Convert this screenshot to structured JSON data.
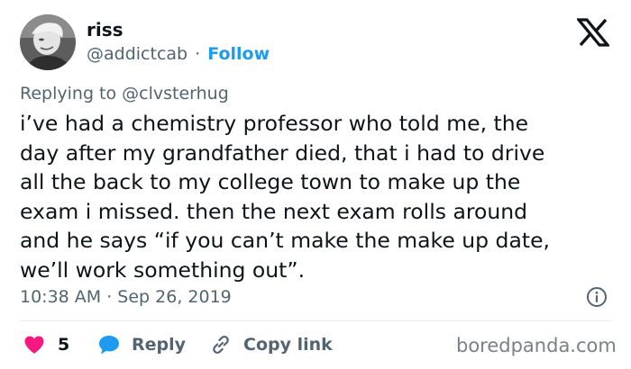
{
  "author": {
    "display_name": "riss",
    "handle": "@addictcab",
    "separator": "·",
    "follow_label": "Follow"
  },
  "reply_context": {
    "text": "Replying to @clvsterhug"
  },
  "tweet": {
    "lines": [
      "i’ve had a chemistry professor who told me, the",
      "day after my grandfather died, that i had to drive",
      "all the back to my college town to make up the",
      "exam i missed. then the next exam rolls around",
      "and he says “if you can’t make the make up date,",
      "we’ll work something out”."
    ],
    "timestamp": "10:38 AM · Sep 26, 2019"
  },
  "actions": {
    "like_count": "5",
    "reply_label": "Reply",
    "copy_label": "Copy link"
  },
  "watermark": "boredpanda.com",
  "colors": {
    "accent": "#1d9bf0",
    "like": "#f91880",
    "secondary_text": "#536471",
    "primary_text": "#0f1419"
  },
  "icons": {
    "brand": "x-logo-icon",
    "like": "heart-icon",
    "reply": "speech-bubble-icon",
    "copy": "link-icon",
    "info": "info-icon"
  }
}
